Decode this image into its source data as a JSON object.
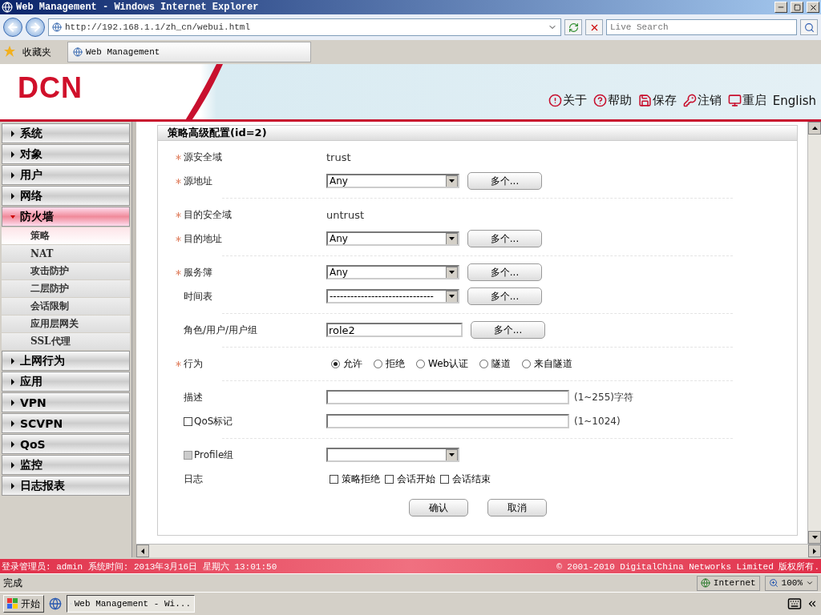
{
  "window": {
    "title": "Web Management - Windows Internet Explorer"
  },
  "address_bar": {
    "url": "http://192.168.1.1/zh_cn/webui.html",
    "search_placeholder": "Live Search"
  },
  "favorites_bar": {
    "favorites": "收藏夹",
    "tab": "Web Management"
  },
  "header": {
    "logo": "DCN",
    "links": [
      {
        "kind": "about",
        "label": "关于"
      },
      {
        "kind": "help",
        "label": "帮助"
      },
      {
        "kind": "save",
        "label": "保存"
      },
      {
        "kind": "logout",
        "label": "注销"
      },
      {
        "kind": "reboot",
        "label": "重启"
      },
      {
        "kind": "plain",
        "label": "English"
      }
    ]
  },
  "sidebar": {
    "items": [
      {
        "label": "系统",
        "expanded": false
      },
      {
        "label": "对象",
        "expanded": false
      },
      {
        "label": "用户",
        "expanded": false
      },
      {
        "label": "网络",
        "expanded": false
      },
      {
        "label": "防火墙",
        "expanded": true,
        "children": [
          {
            "label": "策略",
            "selected": true
          },
          {
            "label": "NAT",
            "selected": false
          },
          {
            "label": "攻击防护",
            "selected": false
          },
          {
            "label": "二层防护",
            "selected": false
          },
          {
            "label": "会话限制",
            "selected": false
          },
          {
            "label": "应用层网关",
            "selected": false
          },
          {
            "label": "SSL代理",
            "selected": false
          }
        ]
      },
      {
        "label": "上网行为",
        "expanded": false
      },
      {
        "label": "应用",
        "expanded": false
      },
      {
        "label": "VPN",
        "expanded": false
      },
      {
        "label": "SCVPN",
        "expanded": false
      },
      {
        "label": "QoS",
        "expanded": false
      },
      {
        "label": "监控",
        "expanded": false
      },
      {
        "label": "日志报表",
        "expanded": false
      }
    ]
  },
  "form": {
    "title": "策略高级配置(id=2)",
    "groups": [
      {
        "rows": [
          {
            "kind": "static",
            "label": "源安全域",
            "required": true,
            "value": "trust"
          },
          {
            "kind": "select",
            "label": "源地址",
            "required": true,
            "value": "Any",
            "button": "多个..."
          }
        ]
      },
      {
        "rows": [
          {
            "kind": "static",
            "label": "目的安全域",
            "required": true,
            "value": "untrust"
          },
          {
            "kind": "select",
            "label": "目的地址",
            "required": true,
            "value": "Any",
            "button": "多个..."
          }
        ]
      },
      {
        "rows": [
          {
            "kind": "select",
            "label": "服务簿",
            "required": true,
            "value": "Any",
            "button": "多个..."
          },
          {
            "kind": "select",
            "label": "时间表",
            "required": false,
            "value": "------------------------------",
            "button": "多个..."
          }
        ]
      },
      {
        "rows": [
          {
            "kind": "input",
            "label": "角色/用户/用户组",
            "required": false,
            "value": "role2",
            "button": "多个..."
          }
        ]
      },
      {
        "rows": [
          {
            "kind": "radios",
            "label": "行为",
            "required": true,
            "options": [
              {
                "label": "允许",
                "selected": true
              },
              {
                "label": "拒绝",
                "selected": false
              },
              {
                "label": "Web认证",
                "selected": false
              },
              {
                "label": "隧道",
                "selected": false
              },
              {
                "label": "来自隧道",
                "selected": false
              }
            ]
          }
        ]
      },
      {
        "rows": [
          {
            "kind": "wide_input",
            "label": "描述",
            "required": false,
            "hint": "(1~255)字符"
          },
          {
            "kind": "wide_input",
            "label": "QoS标记",
            "required": false,
            "check": {
              "checked": false,
              "disabled": false
            },
            "hint": "(1~1024)"
          }
        ]
      },
      {
        "rows": [
          {
            "kind": "select",
            "label": "Profile组",
            "required": false,
            "check": {
              "checked": false,
              "disabled": true
            }
          },
          {
            "kind": "checks",
            "label": "日志",
            "required": false,
            "options": [
              {
                "label": "策略拒绝",
                "checked": false
              },
              {
                "label": "会话开始",
                "checked": false
              },
              {
                "label": "会话结束",
                "checked": false
              }
            ]
          }
        ]
      }
    ],
    "buttons": [
      "确认",
      "取消"
    ]
  },
  "footer": {
    "login": "登录管理员: admin 系统时间: 2013年3月16日 星期六 13:01:50",
    "copyright": "© 2001-2010 DigitalChina Networks Limited 版权所有."
  },
  "status_bar": {
    "status": "完成",
    "zone": "Internet",
    "zoom": "100%"
  },
  "taskbar": {
    "start": "开始",
    "task": "Web Management - Wi..."
  }
}
